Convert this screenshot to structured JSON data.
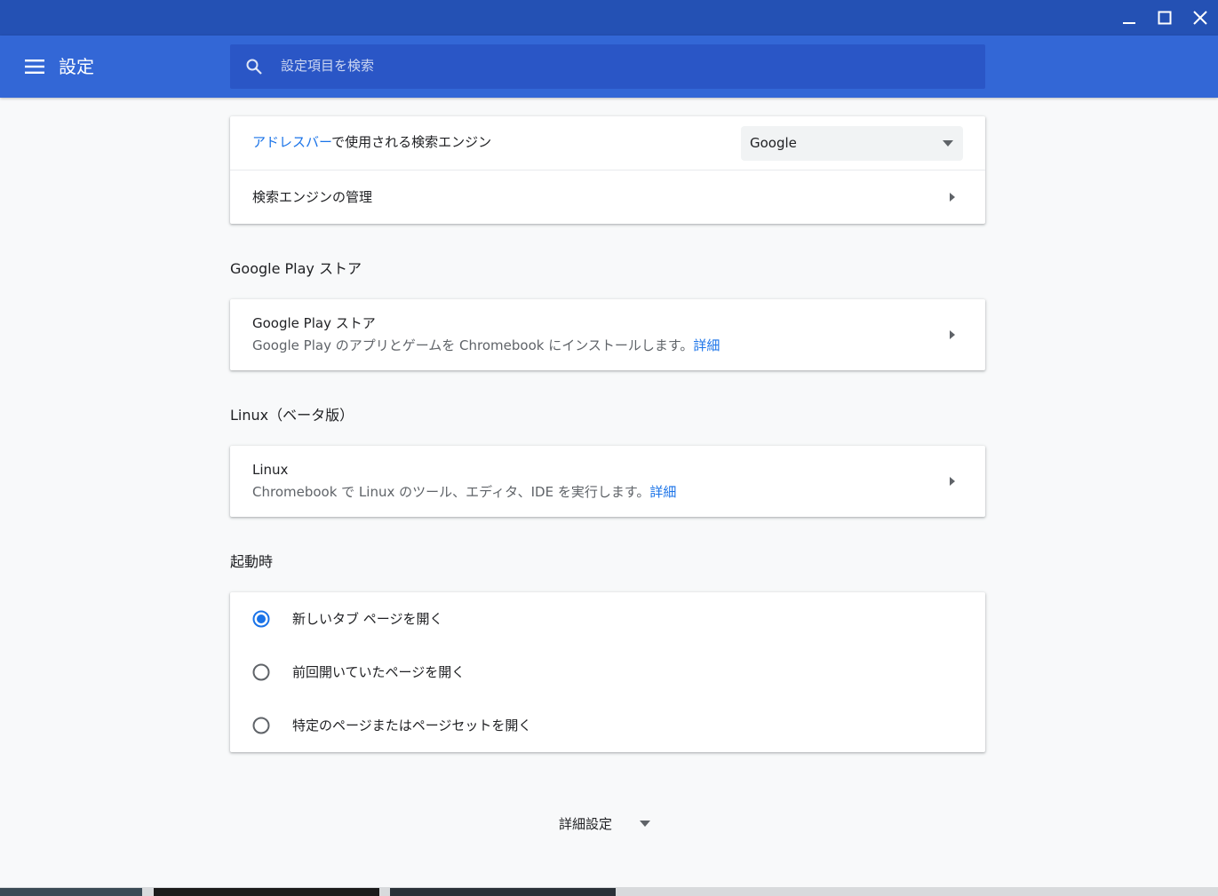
{
  "window": {
    "minimize_icon": "minimize-icon",
    "maximize_icon": "maximize-icon",
    "close_icon": "close-icon"
  },
  "header": {
    "menu_icon": "hamburger-menu-icon",
    "title": "設定",
    "search_placeholder": "設定項目を検索"
  },
  "search_engine_card": {
    "row1_link": "アドレスバー",
    "row1_text": "で使用される検索エンジン",
    "select_value": "Google",
    "row2_label": "検索エンジンの管理"
  },
  "play_store": {
    "section_title": "Google Play ストア",
    "title": "Google Play ストア",
    "description": "Google Play のアプリとゲームを Chromebook にインストールします。",
    "link": "詳細"
  },
  "linux": {
    "section_title": "Linux（ベータ版）",
    "title": "Linux",
    "description": "Chromebook で Linux のツール、エディタ、IDE を実行します。",
    "link": "詳細"
  },
  "startup": {
    "section_title": "起動時",
    "options": [
      {
        "label": "新しいタブ ページを開く",
        "selected": true
      },
      {
        "label": "前回開いていたページを開く",
        "selected": false
      },
      {
        "label": "特定のページまたはページセットを開く",
        "selected": false
      }
    ]
  },
  "advanced": {
    "label": "詳細設定"
  },
  "colors": {
    "titlebar": "#2451b4",
    "appbar": "#3367d6",
    "accent": "#1a73e8"
  }
}
